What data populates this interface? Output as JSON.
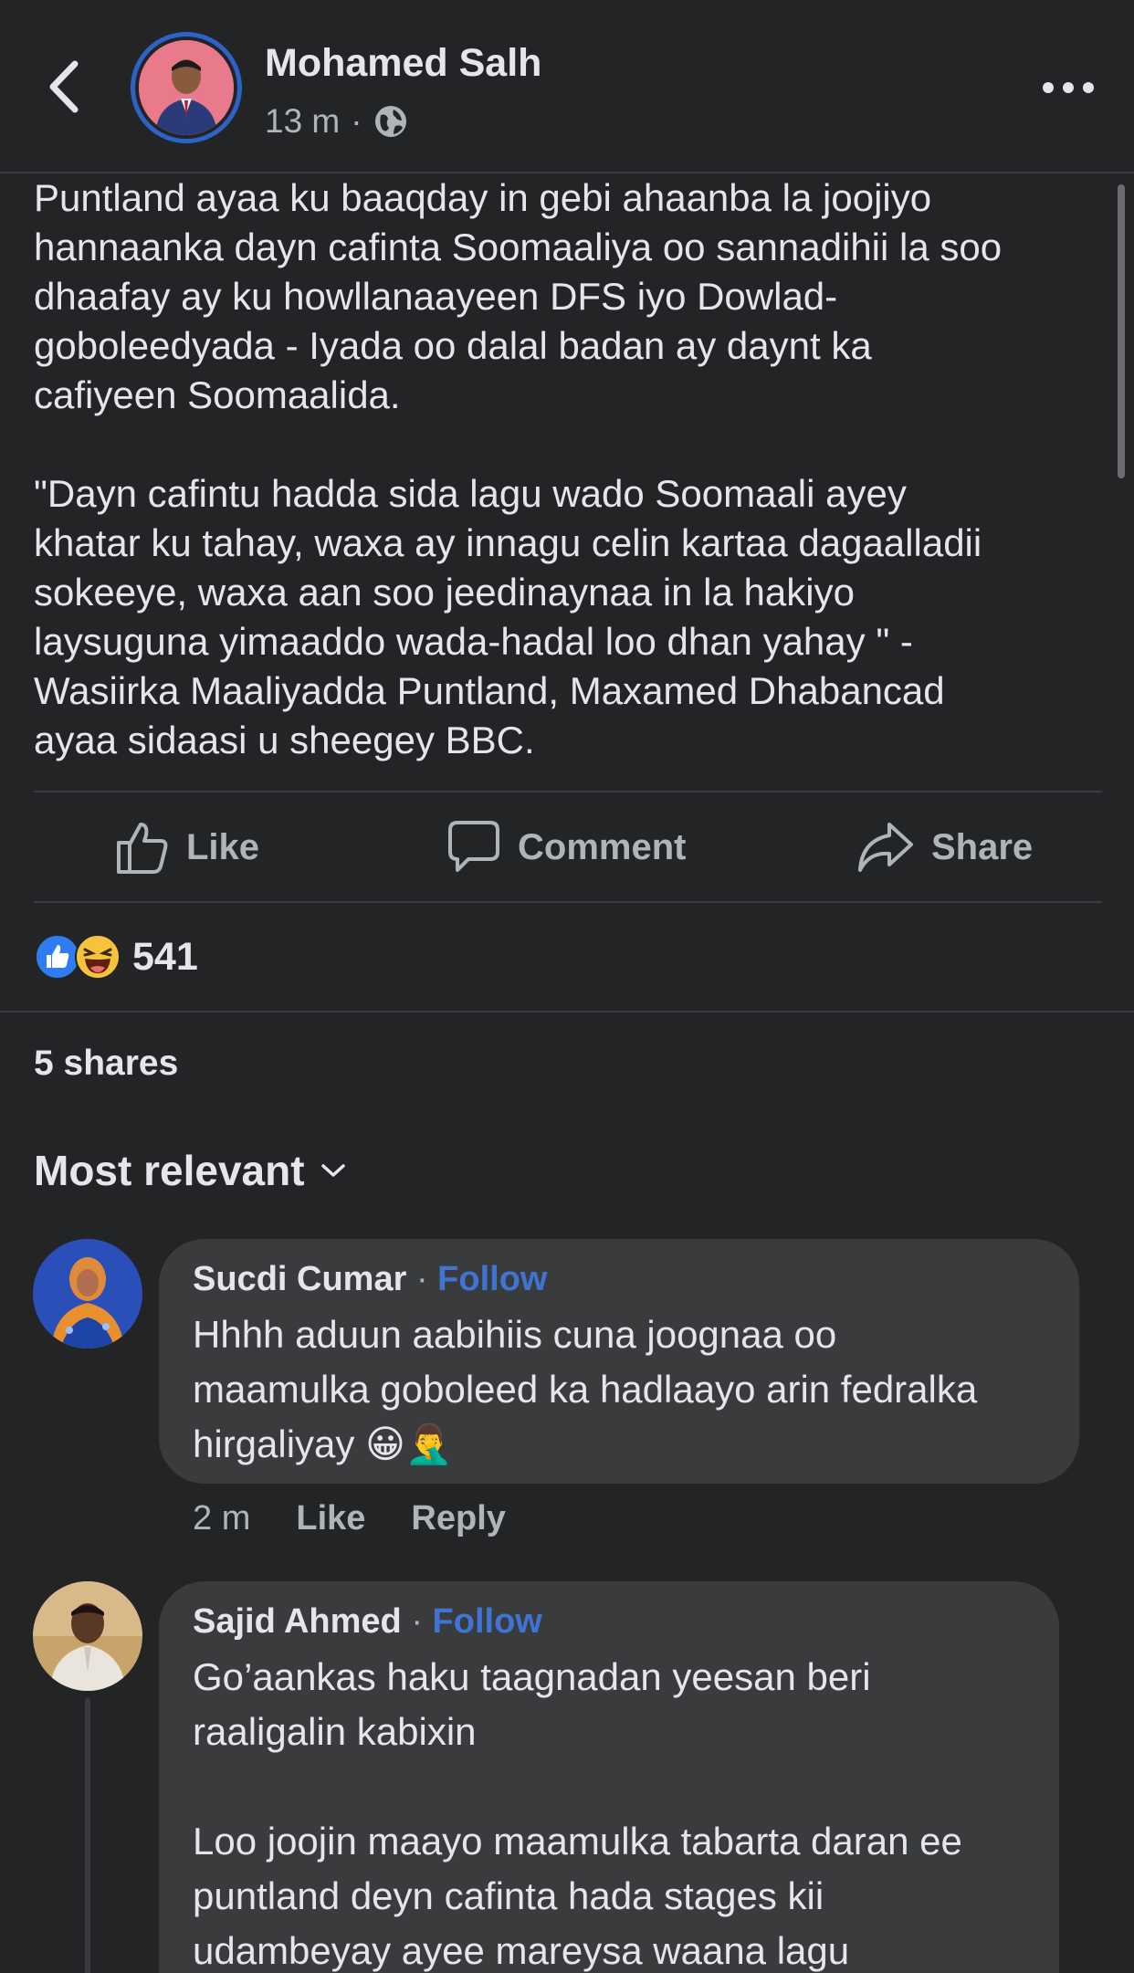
{
  "header": {
    "author_name": "Mohamed Salh",
    "time": "13 m",
    "separator": "·",
    "privacy_icon": "globe-icon",
    "back_icon": "chevron-left-icon",
    "more_icon": "more-horizontal-icon"
  },
  "post": {
    "text": "Puntland ayaa ku baaqday in gebi ahaanba la joojiyo\nhannaanka dayn cafinta Soomaaliya oo sannadihii la soo\ndhaafay ay ku howllanaayeen DFS iyo Dowlad-\ngoboleedyada - Iyada oo dalal badan ay daynt ka\ncafiyeen Soomaalida.\n\n\"Dayn cafintu hadda sida lagu wado Soomaali ayey\nkhatar ku tahay, waxa ay innagu celin kartaa dagaalladii\nsokeeye, waxa aan soo jeedinaynaa in la hakiyo\nlaysuguna yimaaddo wada-hadal loo dhan yahay \" -\nWasiirka Maaliyadda Puntland, Maxamed Dhabancad\nayaa sidaasi u sheegey BBC."
  },
  "actions": {
    "like": "Like",
    "comment": "Comment",
    "share": "Share"
  },
  "reactions": {
    "count": "541",
    "types": [
      "like-icon",
      "haha-icon"
    ]
  },
  "shares_text": "5 shares",
  "sort_label": "Most relevant",
  "comments": [
    {
      "author": "Sucdi Cumar",
      "separator": "·",
      "follow": "Follow",
      "text": "Hhhh aduun aabihiis cuna joognaa oo\nmaamulka goboleed ka hadlaayo arin fedralka\nhirgaliyay 😀🤦‍♂️",
      "time": "2 m",
      "like": "Like",
      "reply": "Reply"
    },
    {
      "author": "Sajid Ahmed",
      "separator": "·",
      "follow": "Follow",
      "text": "Go’aankas haku taagnadan yeesan beri\nraaligalin kabixin\n\nLoo joojin maayo maamulka tabarta daran ee\npuntland deyn cafinta hada stages kii\nudambeyay ayee mareysa waana lagu"
    }
  ],
  "colors": {
    "background": "#232426",
    "bubble": "#3a3b3d",
    "link": "#3f73d4",
    "avatar_ring": "#2d62c8",
    "secondary_text": "#b0b3b8"
  }
}
